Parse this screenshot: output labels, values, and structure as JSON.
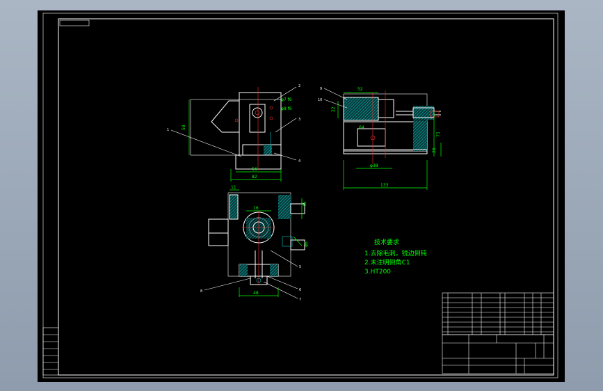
{
  "front_view": {
    "dim_height": "58",
    "dim_base_inner": "56",
    "dim_base_outer": "82",
    "callout_1": "1",
    "callout_2": "2",
    "callout_3": "3",
    "callout_4": "4",
    "fit_top": "φ7 f6",
    "fit_mid": "φ8 f6"
  },
  "side_view": {
    "dim_top": "52",
    "dim_left": "22",
    "dim_bore": "φ38",
    "dim_width": "133",
    "dim_height": "75",
    "dim_base": "20",
    "dim_inner": "64",
    "callout_9": "9",
    "callout_10": "10"
  },
  "top_view": {
    "dim_top": "11",
    "dim_slot": "16",
    "dim_right": "45",
    "dim_bottom": "48",
    "dim_side": "φ6",
    "callout_5": "5",
    "callout_6": "6",
    "callout_7": "7",
    "callout_8": "8"
  },
  "tech_notes": {
    "title": "技术要求",
    "line1": "1.去除毛刺，锐边倒钝",
    "line2": "2.未注明倒角C1",
    "line3": "3.HT200"
  }
}
